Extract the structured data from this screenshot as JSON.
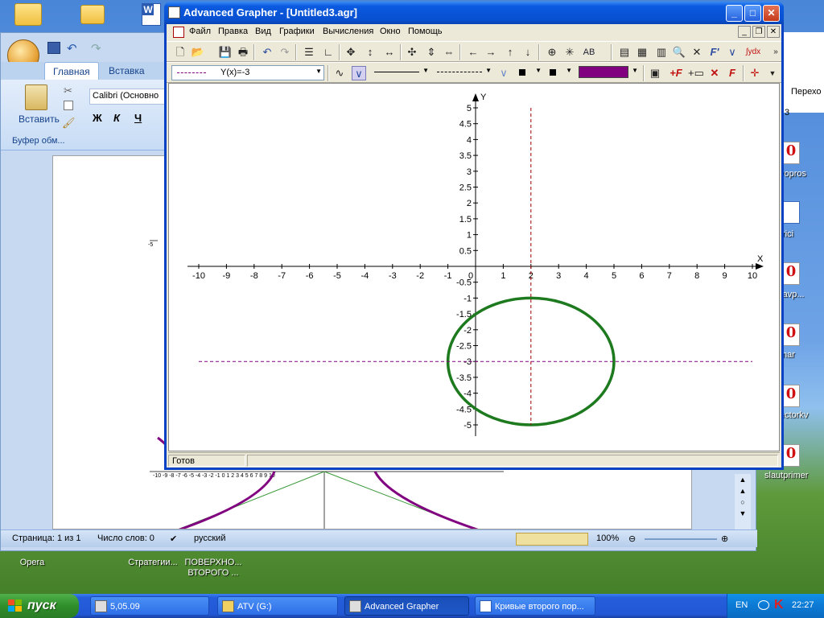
{
  "desktop": {
    "icons": [
      {
        "label": "Opera"
      },
      {
        "label": "Стратегии..."
      },
      {
        "label": "ПОВЕРХНО... ВТОРОГО ..."
      }
    ],
    "right_icons": [
      {
        "label": "vopros"
      },
      {
        "label": "trici"
      },
      {
        "label": "ravp..."
      },
      {
        "label": "mar"
      },
      {
        "label": "ectorkv"
      },
      {
        "label": "slautprimer"
      }
    ],
    "right_header": "Перехо",
    "right_sub": "3"
  },
  "word": {
    "tabs": [
      "Главная",
      "Вставка"
    ],
    "paste_label": "Вставить",
    "clipboard_group": "Буфер обм...",
    "font_name": "Calibri (Основно",
    "bold": "Ж",
    "italic": "К",
    "underline": "Ч",
    "status": {
      "page": "Страница: 1 из 1",
      "words": "Число слов: 0",
      "lang": "русский",
      "zoom": "100%"
    }
  },
  "grapher": {
    "title": "Advanced Grapher - [Untitled3.agr]",
    "menu": [
      "Файл",
      "Правка",
      "Вид",
      "Графики",
      "Вычисления",
      "Окно",
      "Помощь"
    ],
    "function_combo": "Y(x)=-3",
    "status": "Готов",
    "ab_label": "AB",
    "fprime_label": "F'",
    "integral_label": "∫ydx",
    "line_color": "#800080",
    "curve_color": "#1e7a1e"
  },
  "chart_data": {
    "type": "line",
    "xlabel": "X",
    "ylabel": "Y",
    "xlim": [
      -10,
      10
    ],
    "ylim": [
      -5,
      5
    ],
    "x_ticks": [
      "-10",
      "-9",
      "-8",
      "-7",
      "-6",
      "-5",
      "-4",
      "-3",
      "-2",
      "-1",
      "0",
      "1",
      "2",
      "3",
      "4",
      "5",
      "6",
      "7",
      "8",
      "9",
      "10"
    ],
    "y_ticks": [
      "5",
      "4.5",
      "4",
      "3.5",
      "3",
      "2.5",
      "2",
      "1.5",
      "1",
      "0.5",
      "-0.5",
      "-1",
      "-1.5",
      "-2",
      "-2.5",
      "-3",
      "-3.5",
      "-4",
      "-4.5",
      "-5"
    ],
    "series": [
      {
        "kind": "ellipse",
        "center": [
          2,
          -3
        ],
        "rx": 3,
        "ry": 2,
        "color": "#1e7a1e"
      },
      {
        "kind": "hline",
        "y": -3,
        "x_range": [
          -10,
          10
        ],
        "color": "#800080",
        "style": "dashed"
      },
      {
        "kind": "vline",
        "x": 2,
        "y_range": [
          -5,
          5
        ],
        "color": "#a00000",
        "style": "dashed"
      }
    ]
  },
  "taskbar": {
    "start": "пуск",
    "buttons": [
      {
        "label": "5,05.09"
      },
      {
        "label": "ATV (G:)"
      },
      {
        "label": "Advanced Grapher"
      },
      {
        "label": "Кривые второго пор..."
      }
    ],
    "lang": "EN",
    "clock": "22:27"
  }
}
